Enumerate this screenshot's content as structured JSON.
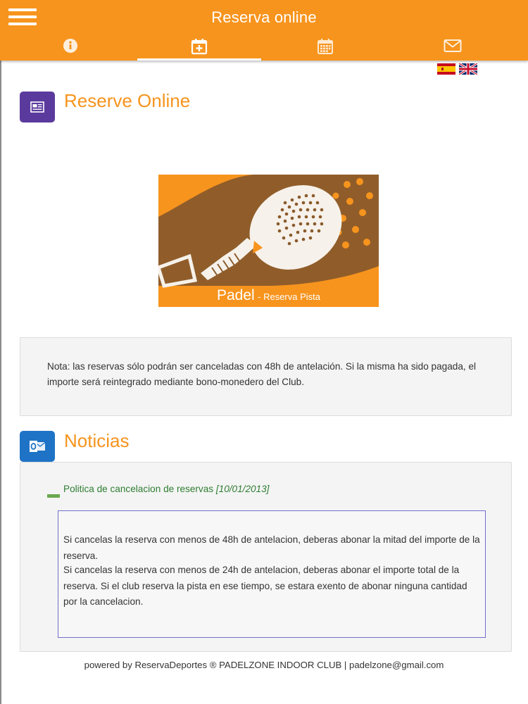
{
  "header": {
    "title": "Reserva online",
    "tabs": [
      {
        "name": "info",
        "icon": "info-icon"
      },
      {
        "name": "booking",
        "icon": "calendar-plus-icon",
        "active": true
      },
      {
        "name": "calendar",
        "icon": "calendar-icon"
      },
      {
        "name": "contact",
        "icon": "envelope-icon"
      }
    ]
  },
  "languages": [
    {
      "code": "es",
      "icon": "spain-flag-icon"
    },
    {
      "code": "en",
      "icon": "uk-flag-icon"
    }
  ],
  "booking_section": {
    "title": "Reserve Online",
    "icon": "newspaper-icon",
    "banner": {
      "title": "Padel",
      "subtitle": "- Reserva Pista",
      "icon": "padel-racket-icon"
    }
  },
  "note": {
    "text": "Nota: las reservas sólo podrán ser canceladas con 48h de antelación. Si la misma ha sido pagada, el importe será reintegrado mediante bono-monedero del Club."
  },
  "news_section": {
    "title": "Noticias",
    "icon": "outlook-icon",
    "items": [
      {
        "headline": "Politica de cancelacion de reservas",
        "date": "[10/01/2013]",
        "paragraphs": [
          "Si cancelas la reserva con menos de 48h de antelacion, deberas abonar la mitad del importe de la reserva.",
          "Si cancelas la reserva con menos de 24h de antelacion, deberas abonar el importe total de la reserva. Si el club reserva la pista en ese tiempo, se estara exento de abonar ninguna cantidad por la cancelacion."
        ]
      }
    ]
  },
  "footer": {
    "text": "powered by ReservaDeportes ® PADELZONE INDOOR CLUB | padelzone@gmail.com"
  },
  "colors": {
    "brand": "#f7941d",
    "booking_icon_bg": "#5b3a9e",
    "news_icon_bg": "#1e73c6",
    "headline": "#2e7d32"
  }
}
